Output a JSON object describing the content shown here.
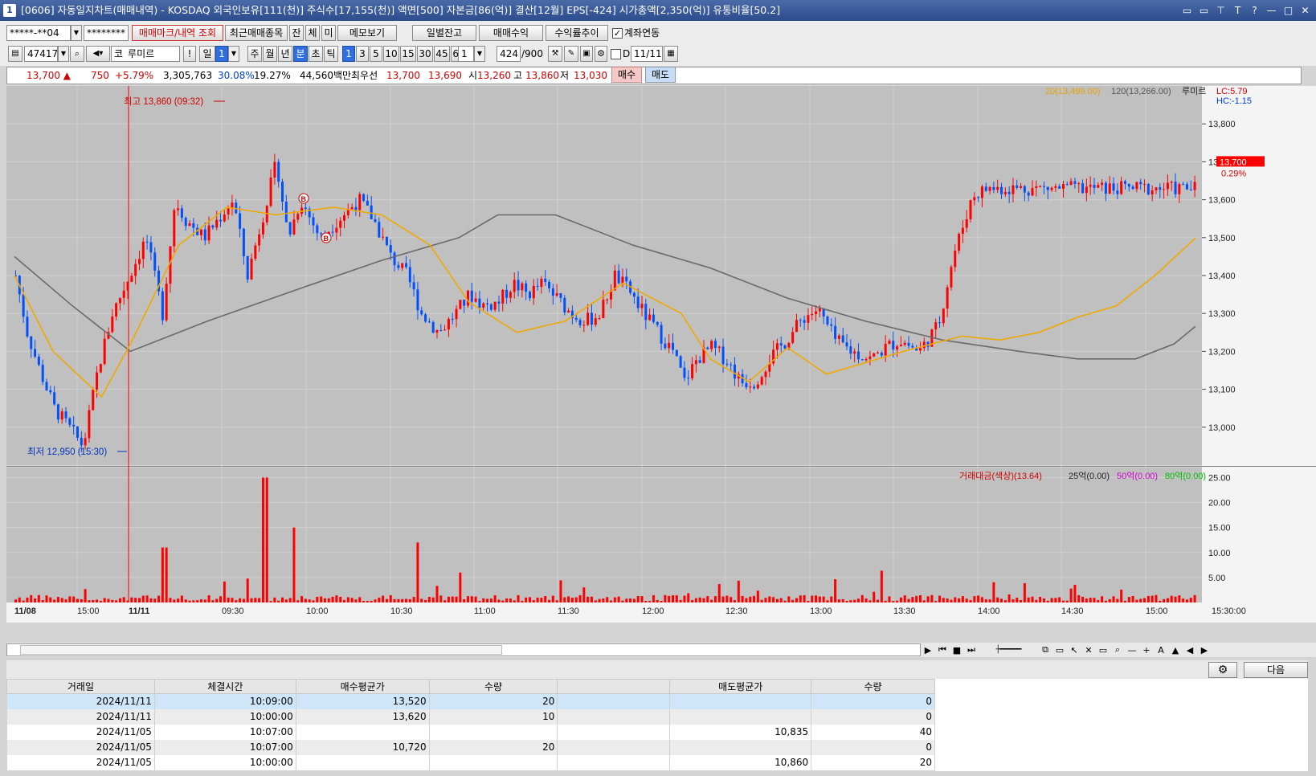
{
  "window": {
    "title": "[0606] 자동일지차트(매매내역) - KOSDAQ 외국인보유[111(천)] 주식수[17,155(천)] 액면[500] 자본금[86(억)] 결산[12월] EPS[-424] 시가총액[2,350(억)] 유통비율[50.2]",
    "icon_label": "1",
    "buttons": [
      "▭",
      "▭",
      "⊤",
      "T",
      "?",
      "—",
      "□",
      "✕"
    ]
  },
  "toolbar1": {
    "account": "*****-**04",
    "password": "********",
    "trade_mark_btn": "매매마크/내역 조회",
    "recent_btn": "최근매매종목",
    "jan": "잔",
    "che": "체",
    "mi": "미",
    "memo_btn": "메모보기",
    "daily_balance_btn": "일별잔고",
    "trade_profit_btn": "매매수익",
    "profit_trend_btn": "수익률추이",
    "account_link_label": "계좌연동",
    "account_link_checked": true
  },
  "toolbar2": {
    "code": "474170",
    "market": "코",
    "stock_name": "루미르",
    "excl": "!",
    "il": "일",
    "num_sel": "1",
    "period_btns": [
      "주",
      "월",
      "년",
      "분",
      "초",
      "틱"
    ],
    "period_active": "분",
    "interval_btns": [
      "1",
      "3",
      "5",
      "10",
      "15",
      "30",
      "45",
      "60"
    ],
    "interval_active": "1",
    "interval_value": "1",
    "count": "424",
    "count_total": "/900",
    "d_label": "D",
    "date": "11/11"
  },
  "quote": {
    "price": "13,700 ▲",
    "change": "750",
    "change_rate": "+5.79%",
    "volume": "3,305,763",
    "rate1": "30.08%",
    "rate2": "19.27%",
    "amount": "44,560백만",
    "best_label": "최우선",
    "best_ask": "13,700",
    "best_bid": "13,690",
    "open_label": "시",
    "open": "13,260",
    "high_label": "고",
    "high": "13,860",
    "low_label": "저",
    "low": "13,030",
    "buy_btn": "매수",
    "sell_btn": "매도"
  },
  "chart_data": {
    "type": "candlestick",
    "price_axis": {
      "min": 12900,
      "max": 13900,
      "ticks": [
        "13,800",
        "13,700",
        "13,600",
        "13,500",
        "13,400",
        "13,300",
        "13,200",
        "13,100",
        "13,000"
      ]
    },
    "volume_axis": {
      "ticks": [
        "25.00",
        "20.00",
        "15.00",
        "10.00",
        "5.00"
      ]
    },
    "time_labels": [
      "11/08",
      "15:00",
      "11/11",
      "09:30",
      "10:00",
      "10:30",
      "11:00",
      "11:30",
      "12:00",
      "12:30",
      "13:00",
      "13:30",
      "14:00",
      "14:30",
      "15:00",
      "15:30:00"
    ],
    "legend_price": {
      "ma20": "20(13,499.00)",
      "ma120": "120(13,266.00)",
      "name": "루미르"
    },
    "lc": "LC:5.79",
    "hc": "HC:-1.15",
    "current_price": "13,700",
    "current_rate": "0.29%",
    "high_note": "최고 13,860 (09:32)",
    "low_note": "최저 12,950 (15:30)",
    "buy_marks": [
      "B",
      "B"
    ],
    "volume_legend": {
      "main": "거래대금(색상)(13.64)",
      "l1": "25억(0.00)",
      "l2": "50억(0.00)",
      "l3": "80억(0.00)"
    },
    "colors": {
      "up": "#ff0000",
      "down": "#0050ff",
      "ma20": "#f0a800",
      "ma120": "#6a6a6a",
      "bg": "#c0c0c0",
      "grid": "#d0d0d0"
    },
    "price_anchors": [
      [
        0,
        13400
      ],
      [
        12,
        13250
      ],
      [
        25,
        13150
      ],
      [
        40,
        13050
      ],
      [
        55,
        13000
      ],
      [
        70,
        12950
      ],
      [
        85,
        13150
      ],
      [
        100,
        13300
      ],
      [
        118,
        13400
      ],
      [
        135,
        13500
      ],
      [
        152,
        13300
      ],
      [
        165,
        13600
      ],
      [
        175,
        13550
      ],
      [
        195,
        13500
      ],
      [
        210,
        13550
      ],
      [
        225,
        13600
      ],
      [
        240,
        13400
      ],
      [
        255,
        13550
      ],
      [
        270,
        13700
      ],
      [
        282,
        13500
      ],
      [
        295,
        13600
      ],
      [
        315,
        13500
      ],
      [
        335,
        13550
      ],
      [
        355,
        13600
      ],
      [
        370,
        13550
      ],
      [
        388,
        13450
      ],
      [
        405,
        13400
      ],
      [
        420,
        13300
      ],
      [
        438,
        13250
      ],
      [
        455,
        13300
      ],
      [
        470,
        13350
      ],
      [
        485,
        13320
      ],
      [
        500,
        13330
      ],
      [
        515,
        13380
      ],
      [
        530,
        13350
      ],
      [
        545,
        13380
      ],
      [
        560,
        13340
      ],
      [
        575,
        13300
      ],
      [
        590,
        13280
      ],
      [
        605,
        13300
      ],
      [
        620,
        13400
      ],
      [
        635,
        13360
      ],
      [
        650,
        13300
      ],
      [
        665,
        13250
      ],
      [
        680,
        13200
      ],
      [
        692,
        13120
      ],
      [
        705,
        13180
      ],
      [
        720,
        13210
      ],
      [
        735,
        13180
      ],
      [
        750,
        13120
      ],
      [
        765,
        13120
      ],
      [
        780,
        13180
      ],
      [
        798,
        13230
      ],
      [
        815,
        13290
      ],
      [
        830,
        13310
      ],
      [
        848,
        13230
      ],
      [
        865,
        13200
      ],
      [
        885,
        13180
      ],
      [
        900,
        13210
      ],
      [
        915,
        13230
      ],
      [
        935,
        13200
      ],
      [
        955,
        13270
      ],
      [
        970,
        13450
      ],
      [
        990,
        13610
      ],
      [
        1005,
        13630
      ]
    ],
    "ma20": [
      [
        0,
        13400
      ],
      [
        40,
        13200
      ],
      [
        90,
        13080
      ],
      [
        120,
        13220
      ],
      [
        170,
        13480
      ],
      [
        220,
        13580
      ],
      [
        270,
        13560
      ],
      [
        330,
        13580
      ],
      [
        380,
        13560
      ],
      [
        430,
        13480
      ],
      [
        470,
        13330
      ],
      [
        520,
        13250
      ],
      [
        570,
        13280
      ],
      [
        630,
        13380
      ],
      [
        690,
        13300
      ],
      [
        720,
        13180
      ],
      [
        760,
        13120
      ],
      [
        800,
        13210
      ],
      [
        840,
        13140
      ],
      [
        880,
        13170
      ],
      [
        920,
        13200
      ],
      [
        980,
        13240
      ],
      [
        1020,
        13230
      ],
      [
        1060,
        13250
      ],
      [
        1100,
        13290
      ],
      [
        1140,
        13320
      ],
      [
        1180,
        13400
      ],
      [
        1222,
        13499
      ]
    ],
    "ma120": [
      [
        0,
        13450
      ],
      [
        60,
        13320
      ],
      [
        120,
        13200
      ],
      [
        200,
        13280
      ],
      [
        300,
        13370
      ],
      [
        380,
        13440
      ],
      [
        460,
        13500
      ],
      [
        500,
        13560
      ],
      [
        560,
        13560
      ],
      [
        640,
        13480
      ],
      [
        720,
        13420
      ],
      [
        800,
        13340
      ],
      [
        880,
        13280
      ],
      [
        960,
        13230
      ],
      [
        1040,
        13200
      ],
      [
        1100,
        13180
      ],
      [
        1160,
        13180
      ],
      [
        1200,
        13220
      ],
      [
        1222,
        13266
      ]
    ]
  },
  "grid": {
    "settings_icon": "gear-icon",
    "next_btn": "다음",
    "columns": [
      "거래일",
      "체결시간",
      "매수평균가",
      "수량",
      "",
      "매도평균가",
      "수량"
    ],
    "rows": [
      [
        "2024/11/11",
        "10:09:00",
        "13,520",
        "20",
        "",
        "",
        "0"
      ],
      [
        "2024/11/11",
        "10:00:00",
        "13,620",
        "10",
        "",
        "",
        "0"
      ],
      [
        "2024/11/05",
        "10:07:00",
        "",
        "",
        "",
        "10,835",
        "40"
      ],
      [
        "2024/11/05",
        "10:07:00",
        "10,720",
        "20",
        "",
        "",
        "0"
      ],
      [
        "2024/11/05",
        "10:00:00",
        "",
        "",
        "",
        "10,860",
        "20"
      ]
    ]
  }
}
